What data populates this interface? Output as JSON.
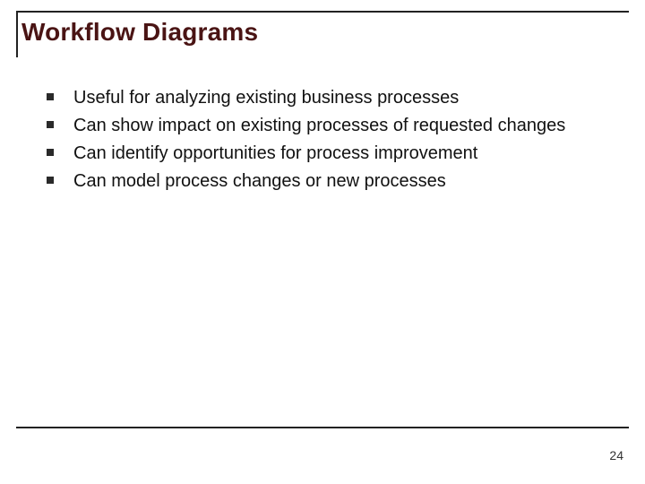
{
  "slide": {
    "title": "Workflow Diagrams",
    "bullets": [
      "Useful for analyzing existing business processes",
      "Can show impact on existing processes of requested changes",
      "Can identify opportunities for process improvement",
      "Can model process changes or new processes"
    ],
    "page_number": "24"
  }
}
